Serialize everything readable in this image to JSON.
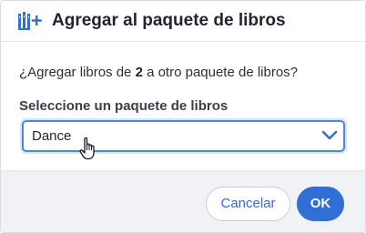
{
  "dialog": {
    "title": "Agregar al paquete de libros",
    "icon": "add-to-bundle-icon"
  },
  "question": {
    "prefix": "¿Agregar libros de ",
    "count": "2",
    "suffix": " a otro paquete de libros?"
  },
  "bundle_select": {
    "label": "Seleccione un paquete de libros",
    "selected_value": "Dance"
  },
  "buttons": {
    "cancel_label": "Cancelar",
    "ok_label": "OK"
  },
  "colors": {
    "accent": "#2f6fd6",
    "focus_border": "#4f86df",
    "footer_bg": "#f0f2f5"
  }
}
